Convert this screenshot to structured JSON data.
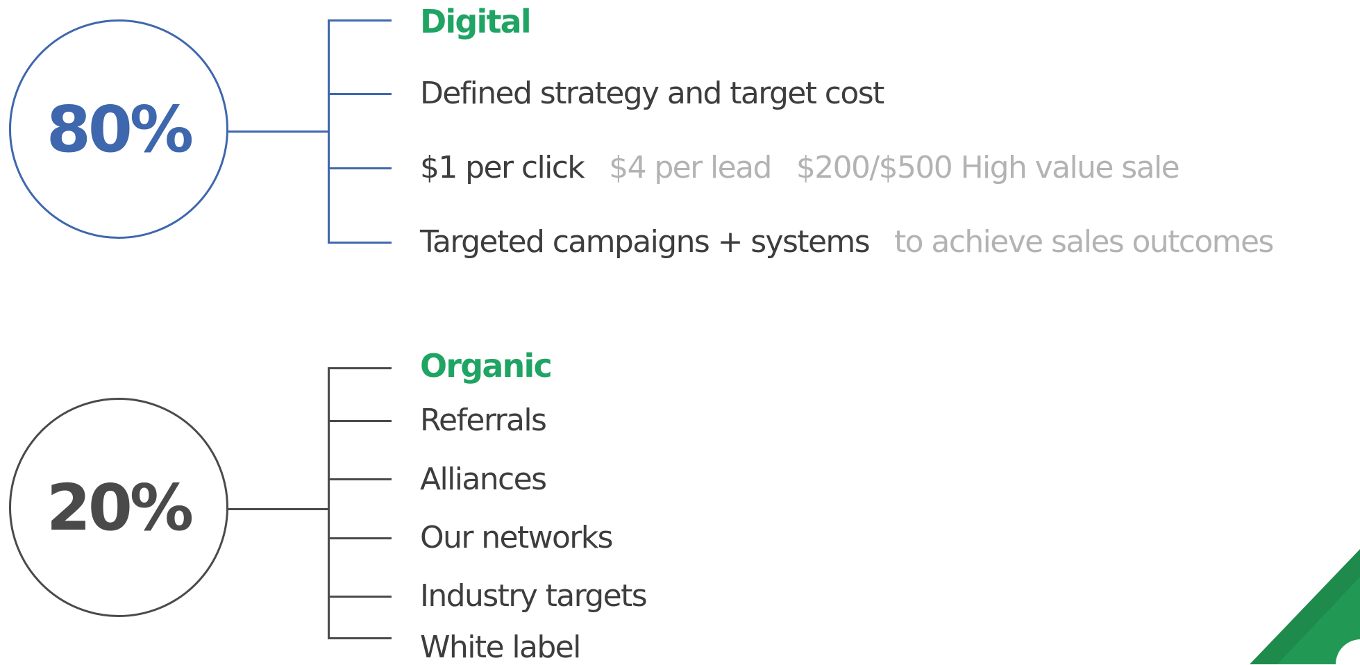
{
  "digital": {
    "percent": "80%",
    "heading": "Digital",
    "items": [
      {
        "main": "Defined strategy and target cost"
      },
      {
        "main": "$1 per click",
        "muted": [
          "$4 per lead",
          "$200/$500 High value sale"
        ]
      },
      {
        "main": "Targeted campaigns + systems",
        "muted": [
          "to achieve sales outcomes"
        ]
      }
    ]
  },
  "organic": {
    "percent": "20%",
    "heading": "Organic",
    "items": [
      "Referrals",
      "Alliances",
      "Our networks",
      "Industry targets",
      "White label"
    ]
  },
  "colors": {
    "digital_blue": "#3f67ad",
    "organic_gray": "#4a4a4a",
    "heading_green": "#1fa463",
    "muted_text": "#b3b3b3",
    "body_text": "#3d3d3d"
  }
}
